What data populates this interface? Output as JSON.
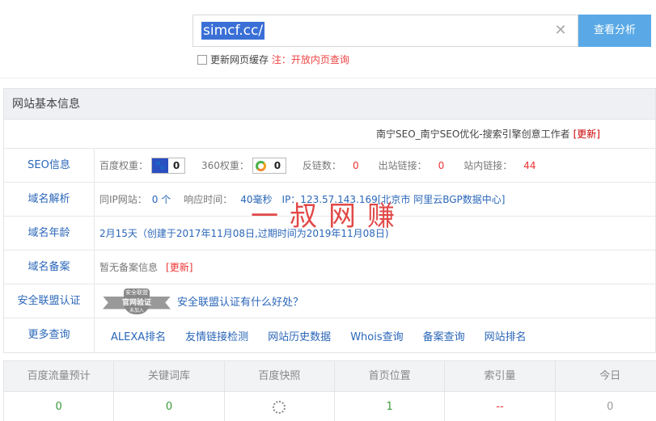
{
  "search": {
    "value": "simcf.cc/",
    "button_label": "查看分析",
    "clear_icon": "close-icon"
  },
  "cache": {
    "label": "更新网页缓存",
    "note": "注：开放内页查询"
  },
  "panel": {
    "title": "网站基本信息",
    "site_title": "南宁SEO_南宁SEO优化-搜索引擎创意工作者",
    "site_update": "[更新]"
  },
  "seo": {
    "label": "SEO信息",
    "baidu_label": "百度权重：",
    "baidu_value": "0",
    "so360_label": "360权重：",
    "so360_value": "0",
    "backlinks_label": "反链数：",
    "backlinks_value": "0",
    "outlinks_label": "出站链接：",
    "outlinks_value": "0",
    "inlinks_label": "站内链接：",
    "inlinks_value": "44"
  },
  "dns": {
    "label": "域名解析",
    "sameip_label": "同IP网站：",
    "sameip_value": "0 个",
    "resp_label": "响应时间：",
    "resp_value": "40毫秒",
    "ip_text": "IP：123.57.143.169[北京市 阿里云BGP数据中心]"
  },
  "age": {
    "label": "域名年龄",
    "value": "2月15天（创建于2017年11月08日,过期时间为2019年11月08日)"
  },
  "icp": {
    "label": "域名备案",
    "value": "暂无备案信息",
    "update": "[更新]"
  },
  "alliance": {
    "label": "安全联盟认证",
    "seal_top": "安全联盟",
    "seal_mid": "官网验证",
    "seal_bottom": "未加入",
    "link": "安全联盟认证有什么好处？"
  },
  "more": {
    "label": "更多查询",
    "links": [
      "ALEXA排名",
      "友情链接检测",
      "网站历史数据",
      "Whois查询",
      "备案查询",
      "网站排名"
    ]
  },
  "watermark": "一叔网赚",
  "stats": {
    "headers": [
      "百度流量预计",
      "关键词库",
      "百度快照",
      "首页位置",
      "索引量",
      "今日"
    ],
    "values": [
      "0",
      "0",
      "",
      "1",
      "--",
      "0"
    ]
  },
  "colors": {
    "accent": "#5aa9e6",
    "link": "#2a66b8",
    "alert": "#e33333",
    "ok": "#3a9a3a"
  }
}
